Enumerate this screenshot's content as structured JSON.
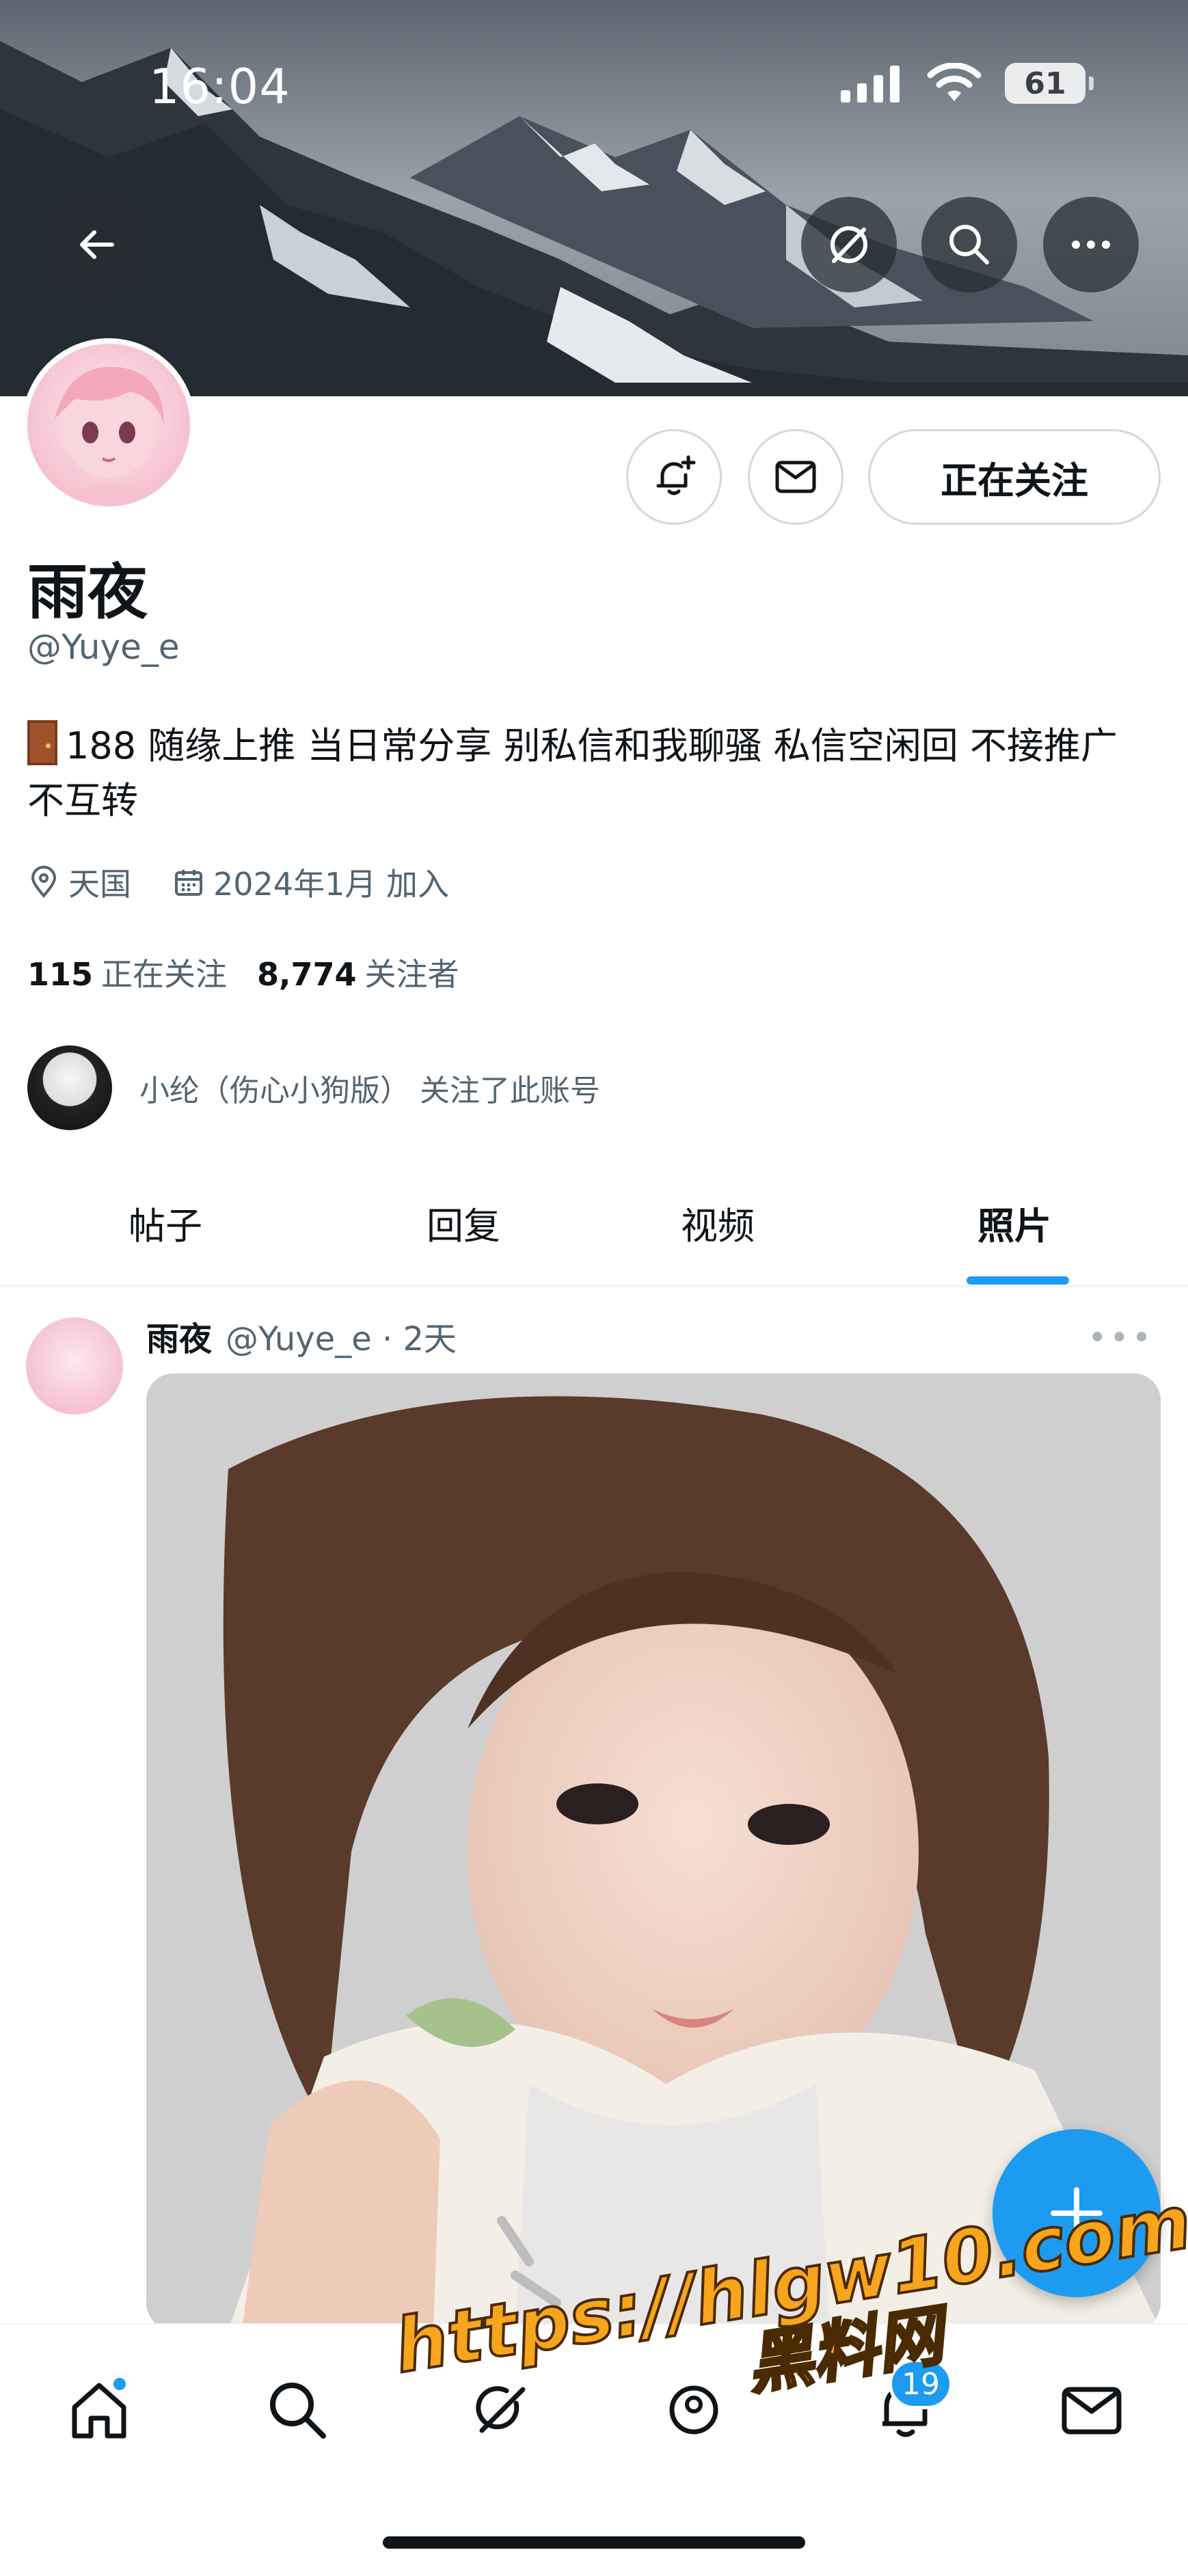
{
  "status_bar": {
    "time": "16:04",
    "battery": "61"
  },
  "profile": {
    "display_name": "雨夜",
    "handle": "@Yuye_e",
    "bio": "188 随缘上推 当日常分享 别私信和我聊骚 私信空闲回 不接推广 不互转",
    "location": "天国",
    "joined": "2024年1月 加入",
    "following_count": "115",
    "following_label": "正在关注",
    "followers_count": "8,774",
    "followers_label": "关注者",
    "follow_button": "正在关注",
    "followed_by": "小纶（伤心小狗版） 关注了此账号"
  },
  "tabs": [
    {
      "label": "帖子"
    },
    {
      "label": "回复"
    },
    {
      "label": "视频"
    },
    {
      "label": "照片",
      "active": true
    }
  ],
  "post": {
    "name": "雨夜",
    "meta": "@Yuye_e · 2天",
    "more": "•••"
  },
  "bottom_nav": {
    "notifications_badge": "19",
    "items": [
      "home-icon",
      "search-icon",
      "grok-icon",
      "communities-icon",
      "bell-icon",
      "mail-icon"
    ]
  },
  "watermark": {
    "url": "https://hlgw10.com",
    "sub": "黑料网"
  },
  "colors": {
    "accent": "#1d9bf0",
    "text": "#0f1419",
    "muted": "#536471"
  }
}
